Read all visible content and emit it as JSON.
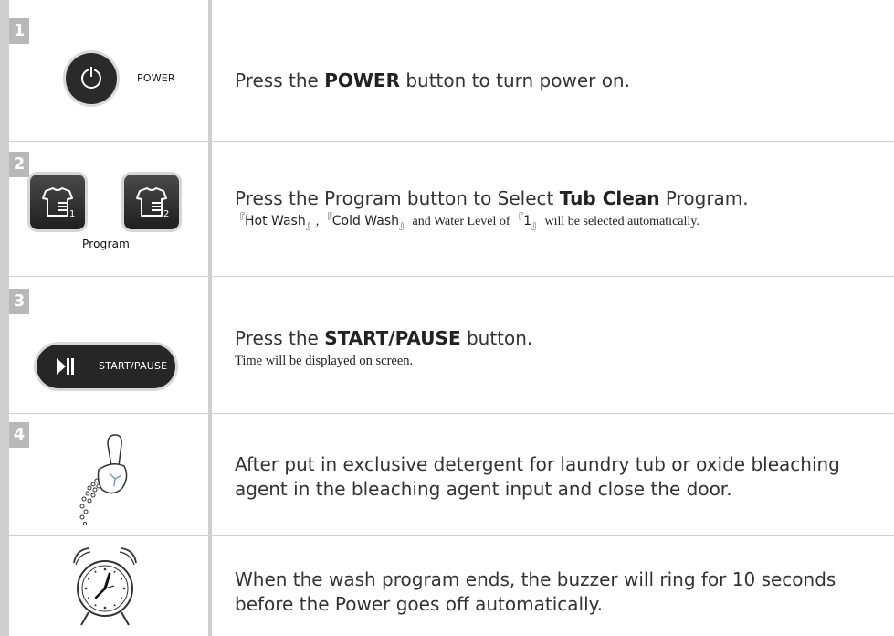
{
  "steps": [
    {
      "number": "1",
      "button_label": "POWER",
      "icon": "power-icon",
      "text_pre": "Press the ",
      "text_bold": "POWER",
      "text_post": " button to turn power on."
    },
    {
      "number": "2",
      "button_label": "Program",
      "icon": "program-icon",
      "text_pre": "Press the Program button to Select ",
      "text_bold": "Tub Clean",
      "text_post": " Program.",
      "sub": {
        "open1": "『",
        "item1": "Hot Wash",
        "close1": "』",
        "comma": ", ",
        "open2": "『",
        "item2": "Cold Wash",
        "close2": "』",
        "mid": " and Water Level of ",
        "open3": "『",
        "item3": "1",
        "close3": "』",
        "end": " will be selected automatically."
      }
    },
    {
      "number": "3",
      "button_label": "START/PAUSE",
      "icon": "play-pause-icon",
      "text_pre": "Press the ",
      "text_bold": "START/PAUSE",
      "text_post": " button.",
      "sub": "Time will be displayed on screen."
    },
    {
      "number": "4",
      "icon": "detergent-scoop-icon",
      "text_line1": "After put in exclusive detergent for laundry tub or oxide bleaching",
      "text_line2": "agent in the bleaching agent input and close the door."
    },
    {
      "icon": "alarm-clock-icon",
      "text_line1": "When the wash program ends, the buzzer will ring for 10 seconds",
      "text_line2": "before the Power goes off automatically."
    }
  ],
  "colors": {
    "border": "#cfcfcf",
    "badge": "#b8b8b8",
    "button": "#262626"
  }
}
